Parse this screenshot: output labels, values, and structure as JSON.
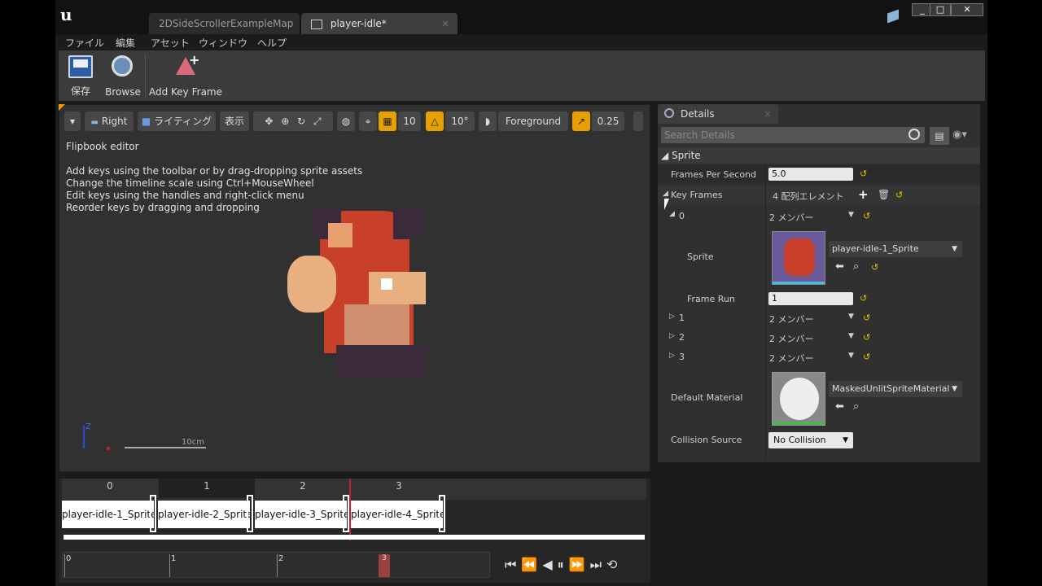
{
  "tabs": [
    {
      "label": "2DSideScrollerExampleMap"
    },
    {
      "label": "player-idle*"
    }
  ],
  "menu": [
    "ファイル",
    "編集",
    "アセット",
    "ウィンドウ",
    "ヘルプ"
  ],
  "toolbar": {
    "save_label": "保存",
    "browse_label": "Browse",
    "add_key_frame_label": "Add Key Frame"
  },
  "viewport_toolbar": {
    "view_label": "Right",
    "lighting_label": "ライティング",
    "show_label": "表示",
    "grid_snap_value": "10",
    "rotation_snap_value": "10°",
    "layer_label": "Foreground",
    "scale_snap_value": "0.25"
  },
  "viewport": {
    "title": "Flipbook editor",
    "help_lines": [
      "Add keys using the toolbar or by drag-dropping sprite assets",
      "Change the timeline scale using Ctrl+MouseWheel",
      "Edit keys using the handles and right-click menu",
      "Reorder keys by dragging and dropping"
    ],
    "scale_label": "10cm",
    "axis_label": "Z"
  },
  "timeline": {
    "frame_numbers": [
      "0",
      "1",
      "2",
      "3"
    ],
    "frames": [
      "player-idle-1_Sprite",
      "player-idle-2_Sprite",
      "player-idle-3_Sprite",
      "player-idle-4_Sprite"
    ],
    "scrub_ticks": [
      "0",
      "1",
      "2",
      "3"
    ]
  },
  "details": {
    "tab_label": "Details",
    "search_placeholder": "Search Details",
    "section_label": "Sprite",
    "fps_label": "Frames Per Second",
    "fps_value": "5.0",
    "key_frames_label": "Key Frames",
    "key_frames_value": "4 配列エレメント",
    "item0_label": "0",
    "item0_value": "2 メンバー",
    "sprite_label": "Sprite",
    "sprite_value": "player-idle-1_Sprite",
    "frame_run_label": "Frame Run",
    "frame_run_value": "1",
    "item1_label": "1",
    "item1_value": "2 メンバー",
    "item2_label": "2",
    "item2_value": "2 メンバー",
    "item3_label": "3",
    "item3_value": "2 メンバー",
    "default_material_label": "Default Material",
    "default_material_value": "MaskedUnlitSpriteMaterial",
    "collision_source_label": "Collision Source",
    "collision_source_value": "No Collision"
  },
  "colors": {
    "accent_orange": "#e8a000",
    "playhead_red": "#c0202a",
    "background": "#1b1b1b"
  }
}
